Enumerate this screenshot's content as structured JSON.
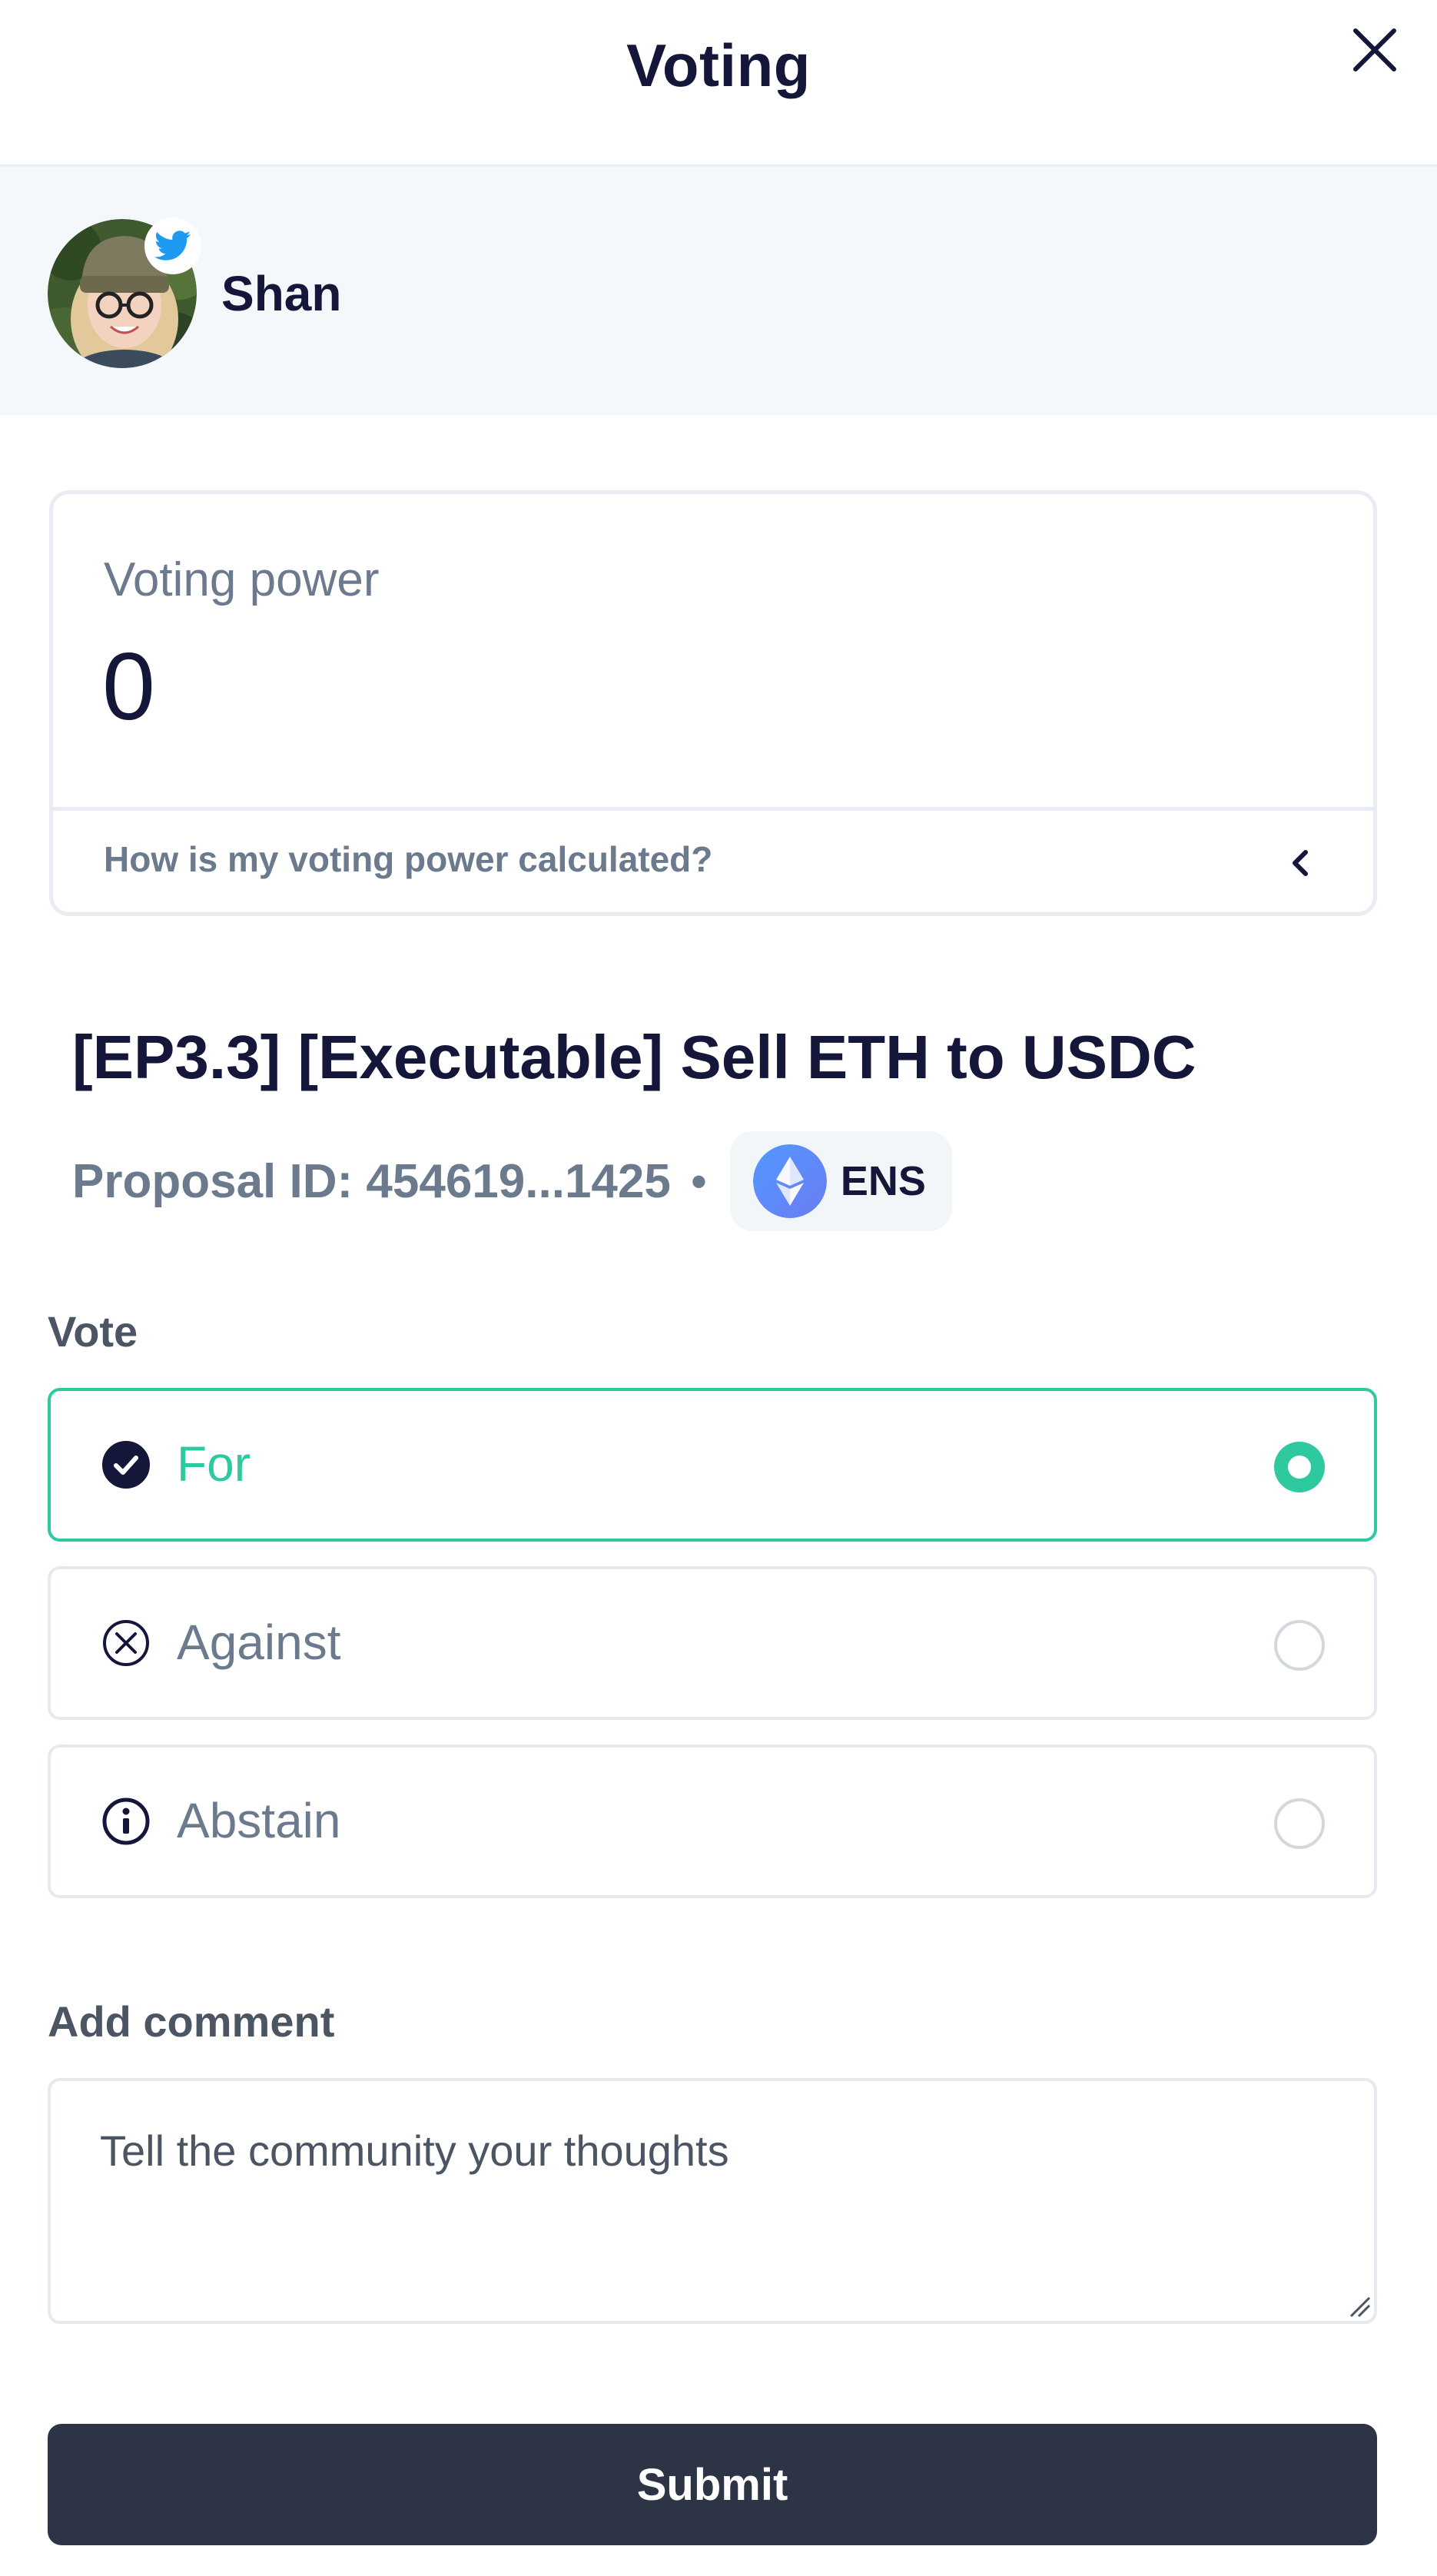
{
  "header": {
    "title": "Voting"
  },
  "user": {
    "name": "Shan",
    "badge_icon": "twitter-icon"
  },
  "voting_power": {
    "label": "Voting power",
    "value": "0",
    "faq_text": "How is my voting power calculated?"
  },
  "proposal": {
    "title": "[EP3.3] [Executable] Sell ETH to USDC",
    "id_text": "Proposal ID: 454619...1425",
    "separator": "•",
    "dao_name": "ENS"
  },
  "vote": {
    "heading": "Vote",
    "selected": "For",
    "options": [
      {
        "label": "For",
        "icon": "check-circle-icon"
      },
      {
        "label": "Against",
        "icon": "x-circle-icon"
      },
      {
        "label": "Abstain",
        "icon": "info-circle-icon"
      }
    ]
  },
  "comment": {
    "heading": "Add comment",
    "placeholder": "Tell the community your thoughts",
    "value": ""
  },
  "submit": {
    "label": "Submit"
  },
  "colors": {
    "accent": "#2fc9a0",
    "text_primary": "#14163a",
    "text_muted": "#6b7a8d",
    "button_bg": "#2d3445",
    "panel_bg": "#f5f8fb",
    "twitter_blue": "#1d9bf0",
    "ens_blue": "#5b8def"
  }
}
